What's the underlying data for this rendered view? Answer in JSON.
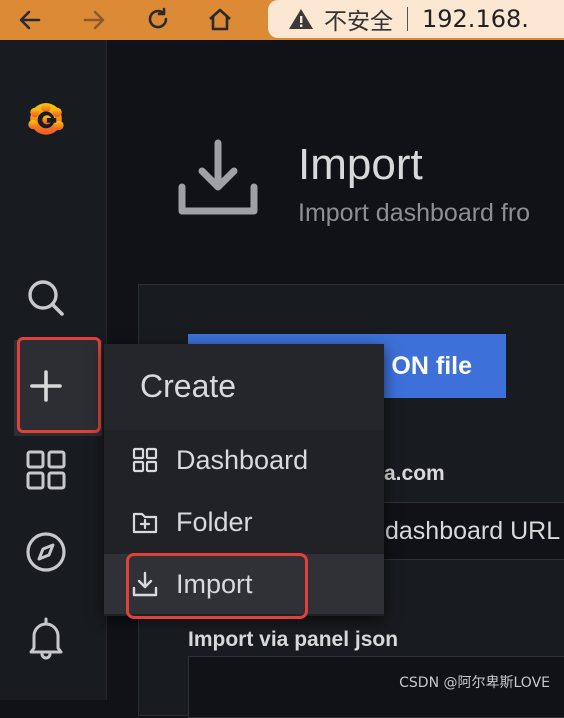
{
  "browser": {
    "security_label": "不安全",
    "url": "192.168."
  },
  "page": {
    "title": "Import",
    "subtitle": "Import dashboard fro"
  },
  "content": {
    "upload_button_label": "ON file",
    "grafana_com_label": "a.com",
    "url_input_value": "dashboard URL",
    "panel_json_label": "Import via panel json"
  },
  "create_menu": {
    "title": "Create",
    "items": [
      {
        "label": "Dashboard",
        "icon": "apps-grid-icon"
      },
      {
        "label": "Folder",
        "icon": "folder-plus-icon"
      },
      {
        "label": "Import",
        "icon": "import-icon"
      }
    ],
    "active_item": "Import"
  },
  "sidebar": {
    "items": [
      "grafana-logo",
      "search-icon",
      "plus-icon",
      "dashboards-icon",
      "explore-icon",
      "bell-icon"
    ]
  },
  "colors": {
    "accent_blue": "#3d71d9",
    "highlight_red": "#e0413a",
    "browser_bar": "#dd8a37"
  },
  "watermark": "CSDN @阿尔卑斯LOVE"
}
